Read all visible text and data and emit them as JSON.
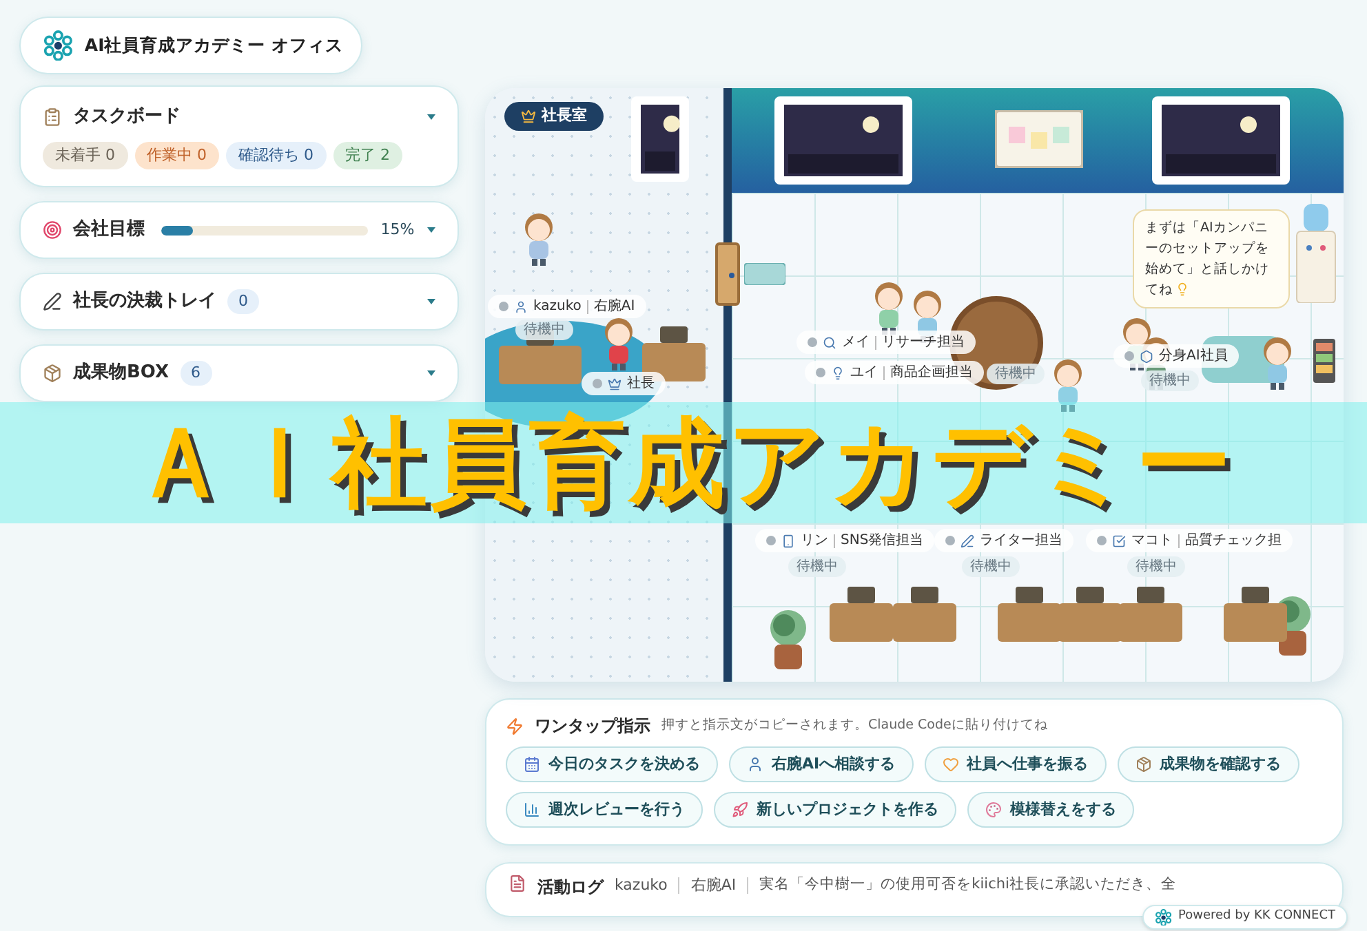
{
  "header": {
    "title": "AI社員育成アカデミー オフィス"
  },
  "sidebar": {
    "task_board": {
      "title": "タスクボード",
      "tags": [
        {
          "label": "未着手 0",
          "color": "#efe9de"
        },
        {
          "label": "作業中 0",
          "color": "#fde3cc"
        },
        {
          "label": "確認待ち 0",
          "color": "#e6f0fa"
        },
        {
          "label": "完了 2",
          "color": "#dff0e2"
        }
      ]
    },
    "goal": {
      "title": "会社目標",
      "level": 0.15,
      "reading": "15%"
    },
    "tray": {
      "title": "社長の決裁トレイ",
      "count": "0"
    },
    "box": {
      "title": "成果物BOX",
      "count": "6"
    }
  },
  "office": {
    "room_label": "社長室",
    "bubble": "まずは「AIカンパニーのセットアップを始めて」と話しかけてね",
    "characters": [
      {
        "name": "kazuko",
        "role": "右腕AI",
        "status": "待機中"
      },
      {
        "name": "社長"
      },
      {
        "name": "メイ",
        "role": "リサーチ担当"
      },
      {
        "name": "ユイ",
        "role": "商品企画担当",
        "status": "待機中"
      },
      {
        "name": "分身AI社員",
        "status": "待機中"
      },
      {
        "name": "リン",
        "role": "SNS発信担当",
        "status": "待機中"
      },
      {
        "role": "ライター担当",
        "status": "待機中"
      },
      {
        "name": "マコト",
        "role": "品質チェック担",
        "status": "待機中"
      }
    ]
  },
  "quick": {
    "title": "ワンタップ指示",
    "hint": "押すと指示文がコピーされます。Claude Codeに貼り付けてね",
    "buttons": [
      "今日のタスクを決める",
      "右腕AIへ相談する",
      "社員へ仕事を振る",
      "成果物を確認する",
      "週次レビューを行う",
      "新しいプロジェクトを作る",
      "模様替えをする"
    ]
  },
  "log": {
    "title": "活動ログ",
    "user": "kazuko",
    "role": "右腕AI",
    "message": "実名「今中樹一」の使用可否をkiichi社長に承認いただき、全"
  },
  "badge": "Powered by KK CONNECT",
  "banner": "ＡＩ社員育成アカデミー"
}
